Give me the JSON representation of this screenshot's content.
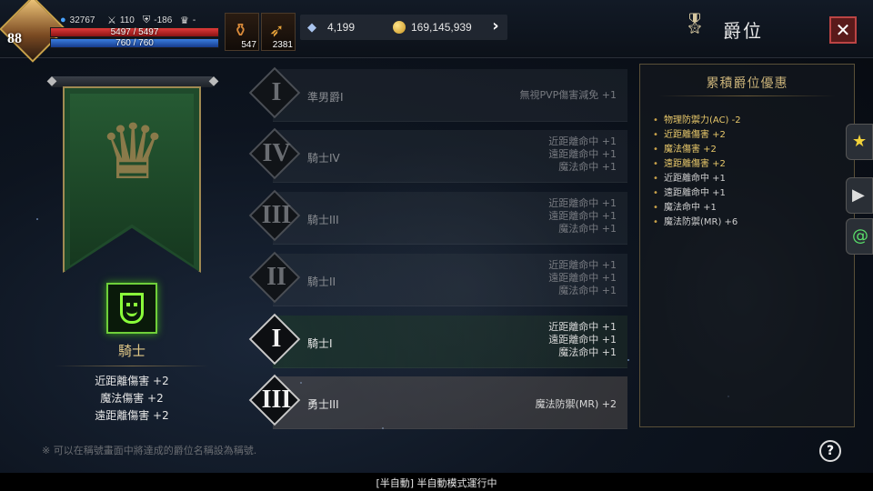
{
  "player": {
    "level": "88",
    "exp_value": "32767",
    "stat_a": "110",
    "stat_b": "-186",
    "trophy": "-",
    "hp": "5497 / 5497",
    "mp": "760 / 760",
    "hp_fill": 1.0,
    "mp_fill": 1.0
  },
  "items": [
    {
      "icon": "potion-icon",
      "count": "547"
    },
    {
      "icon": "horn-icon",
      "count": "2381"
    }
  ],
  "currency": {
    "gems": "4,199",
    "gold": "169,145,939"
  },
  "header": {
    "title": "爵位",
    "close": "✕"
  },
  "current_rank": {
    "name": "騎士",
    "bonuses": [
      "近距離傷害 +2",
      "魔法傷害 +2",
      "遠距離傷害 +2"
    ]
  },
  "ranks": [
    {
      "numeral": "I",
      "name": "準男爵I",
      "effects": [
        "無視PVP傷害減免 +1"
      ],
      "state": "locked"
    },
    {
      "numeral": "IV",
      "name": "騎士IV",
      "effects": [
        "近距離命中 +1",
        "遠距離命中 +1",
        "魔法命中 +1"
      ],
      "state": "locked"
    },
    {
      "numeral": "III",
      "name": "騎士III",
      "effects": [
        "近距離命中 +1",
        "遠距離命中 +1",
        "魔法命中 +1"
      ],
      "state": "locked"
    },
    {
      "numeral": "II",
      "name": "騎士II",
      "effects": [
        "近距離命中 +1",
        "遠距離命中 +1",
        "魔法命中 +1"
      ],
      "state": "locked"
    },
    {
      "numeral": "I",
      "name": "騎士I",
      "effects": [
        "近距離命中 +1",
        "遠距離命中 +1",
        "魔法命中 +1"
      ],
      "state": "lit"
    },
    {
      "numeral": "III",
      "name": "勇士III",
      "effects": [
        "魔法防禦(MR) +2"
      ],
      "state": "current"
    }
  ],
  "accumulated": {
    "title": "累積爵位優惠",
    "items": [
      {
        "text": "物理防禦力(AC) -2",
        "highlight": true
      },
      {
        "text": "近距離傷害 +2",
        "highlight": true
      },
      {
        "text": "魔法傷害 +2",
        "highlight": true
      },
      {
        "text": "遠距離傷害 +2",
        "highlight": true
      },
      {
        "text": "近距離命中 +1",
        "highlight": false
      },
      {
        "text": "遠距離命中 +1",
        "highlight": false
      },
      {
        "text": "魔法命中 +1",
        "highlight": false
      },
      {
        "text": "魔法防禦(MR) +6",
        "highlight": false
      }
    ]
  },
  "footer": {
    "note": "※ 可以在稱號畫面中將達成的爵位名稱設為稱號.",
    "help": "?",
    "auto_status": "[半自動] 半自動模式運行中"
  },
  "colors": {
    "accent_gold": "#c9a24a",
    "hp_red": "#e03a3a",
    "mp_blue": "#3a7ee0",
    "banner_green": "#1f4a2b",
    "emblem_green": "#8aff3a"
  }
}
